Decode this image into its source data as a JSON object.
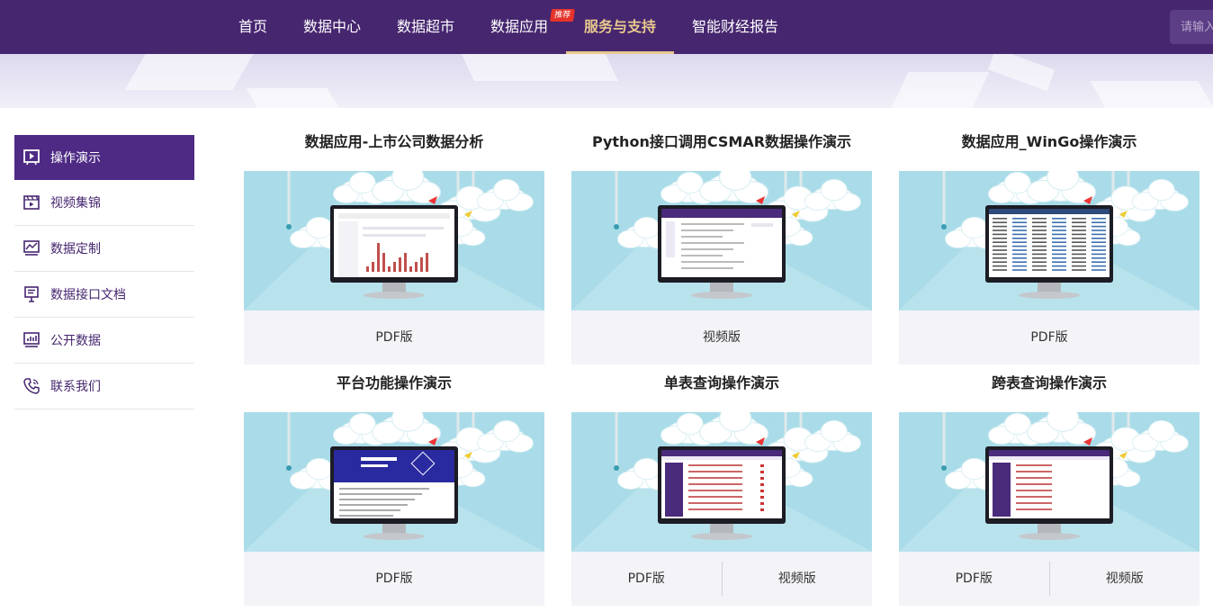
{
  "nav": {
    "items": [
      "首页",
      "数据中心",
      "数据超市",
      "数据应用",
      "服务与支持",
      "智能财经报告"
    ],
    "badge": "推荐",
    "active_index": 4,
    "search_placeholder": "请输入"
  },
  "sidebar": {
    "items": [
      {
        "label": "操作演示",
        "icon": "presentation-icon",
        "active": true
      },
      {
        "label": "视频集锦",
        "icon": "video-clip-icon",
        "active": false
      },
      {
        "label": "数据定制",
        "icon": "chart-monitor-icon",
        "active": false
      },
      {
        "label": "数据接口文档",
        "icon": "document-board-icon",
        "active": false
      },
      {
        "label": "公开数据",
        "icon": "bar-chart-monitor-icon",
        "active": false
      },
      {
        "label": "联系我们",
        "icon": "phone-icon",
        "active": false
      }
    ]
  },
  "cards": [
    {
      "title": "数据应用-上市公司数据分析",
      "screen": "bar-chart",
      "links": [
        "PDF版"
      ]
    },
    {
      "title": "Python接口调用CSMAR数据操作演示",
      "screen": "form",
      "links": [
        "视频版"
      ]
    },
    {
      "title": "数据应用_WinGo操作演示",
      "screen": "dense-table",
      "links": [
        "PDF版"
      ]
    },
    {
      "title": "平台功能操作演示",
      "screen": "banner-page",
      "links": [
        "PDF版"
      ]
    },
    {
      "title": "单表查询操作演示",
      "screen": "query-list",
      "links": [
        "PDF版",
        "视频版"
      ]
    },
    {
      "title": "跨表查询操作演示",
      "screen": "query-list-2",
      "links": [
        "PDF版",
        "视频版"
      ]
    }
  ],
  "colors": {
    "nav_bg": "#46266f",
    "accent": "#e8c98d",
    "sidebar_active": "#4e2a84",
    "thumb_sky": "#a9dce8"
  }
}
